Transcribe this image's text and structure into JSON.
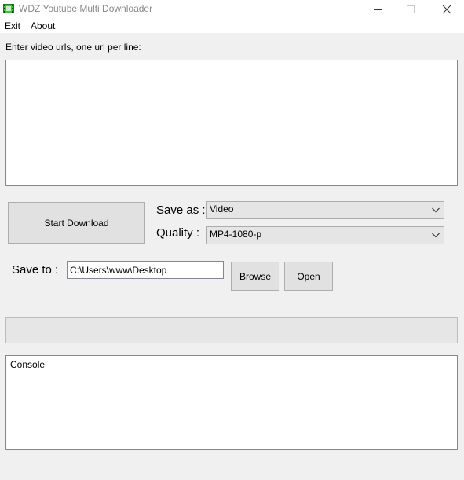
{
  "window": {
    "title": "WDZ Youtube Multi Downloader",
    "accent": "#2ea043"
  },
  "menu": {
    "items": [
      {
        "label": "Exit"
      },
      {
        "label": "About"
      }
    ]
  },
  "urls": {
    "label": "Enter video urls, one url per line:",
    "value": ""
  },
  "actions": {
    "start_label": "Start Download",
    "browse_label": "Browse",
    "open_label": "Open"
  },
  "options": {
    "save_as_label": "Save as :",
    "save_as_value": "Video",
    "quality_label": "Quality :",
    "quality_value": "MP4-1080-p",
    "save_to_label": "Save to :",
    "save_to_value": "C:\\Users\\www\\Desktop"
  },
  "progress": {
    "value": 0
  },
  "console": {
    "text": "Console"
  }
}
